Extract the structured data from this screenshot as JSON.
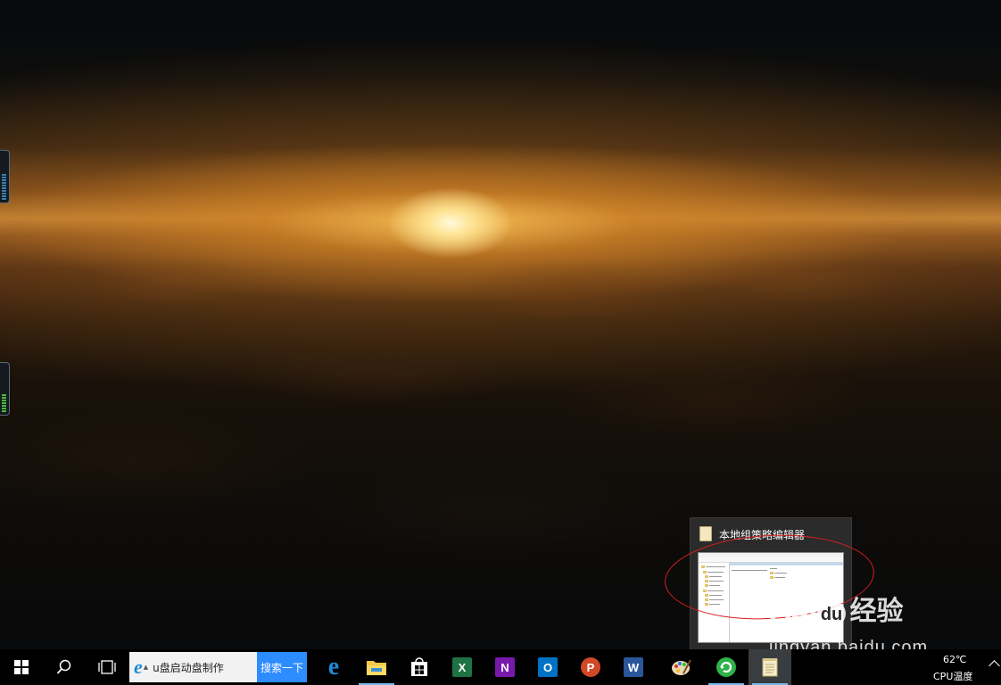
{
  "preview": {
    "title": "本地组策略编辑器"
  },
  "taskbar": {
    "search_value": "u盘启动盘制作",
    "search_button": "搜索一下",
    "apps": [
      {
        "name": "Microsoft Edge",
        "icon": "edge-icon"
      },
      {
        "name": "File Explorer",
        "icon": "folder-icon"
      },
      {
        "name": "Microsoft Store",
        "icon": "store-icon"
      },
      {
        "name": "Excel",
        "icon": "excel-icon",
        "letter": "X"
      },
      {
        "name": "OneNote",
        "icon": "onenote-icon",
        "letter": "N"
      },
      {
        "name": "Outlook",
        "icon": "outlook-icon",
        "letter": "O"
      },
      {
        "name": "PowerPoint",
        "icon": "powerpoint-icon",
        "letter": "P"
      },
      {
        "name": "Word",
        "icon": "word-icon",
        "letter": "W"
      },
      {
        "name": "Paint",
        "icon": "paint-icon"
      },
      {
        "name": "Browser",
        "icon": "refresh-browser-icon"
      },
      {
        "name": "本地组策略编辑器",
        "icon": "notepad-icon"
      }
    ]
  },
  "tray": {
    "temperature": "62℃",
    "cpu_label": "CPU温度"
  },
  "watermark": {
    "brand": "Bai",
    "brand_suffix": "du",
    "brand_cn": "经验",
    "url": "jingyan.baidu.com"
  },
  "colors": {
    "taskbar": "#000000",
    "accent": "#2d8cff",
    "annotation": "#d81e1e",
    "excel": "#1f7244",
    "onenote": "#7719aa",
    "outlook": "#0072c6",
    "powerpoint": "#d24726",
    "word": "#2b579a"
  }
}
